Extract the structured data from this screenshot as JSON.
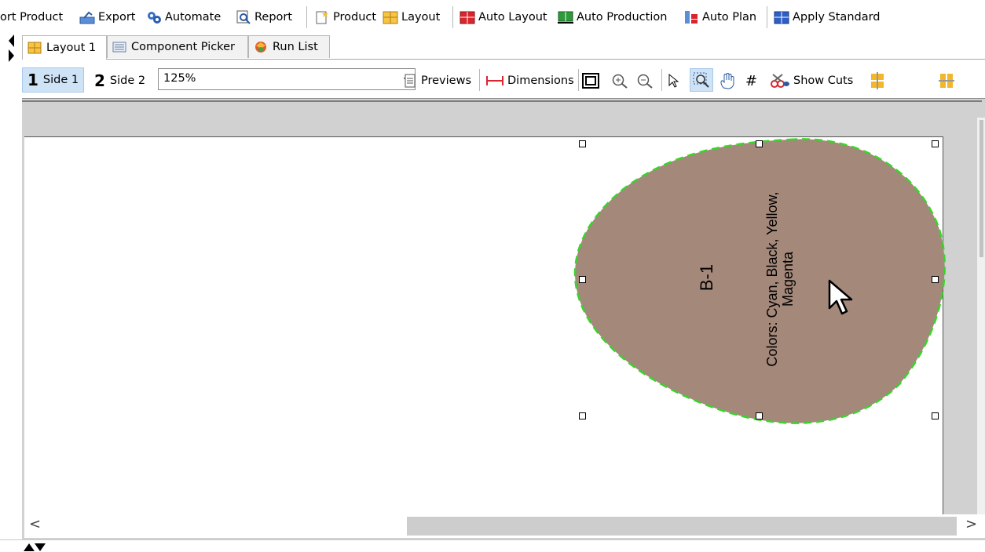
{
  "toolbar": {
    "import_product": "ort Product",
    "export": "Export",
    "automate": "Automate",
    "report": "Report",
    "product": "Product",
    "layout": "Layout",
    "auto_layout": "Auto Layout",
    "auto_production": "Auto Production",
    "auto_plan": "Auto Plan",
    "apply_standard": "Apply Standard"
  },
  "tabs": [
    {
      "label": "Layout 1",
      "active": true
    },
    {
      "label": "Component Picker",
      "active": false
    },
    {
      "label": "Run List",
      "active": false
    }
  ],
  "view_toolbar": {
    "side1_num": "1",
    "side1_label": "Side 1",
    "side2_num": "2",
    "side2_label": "Side 2",
    "zoom": "125%",
    "previews": "Previews",
    "dimensions": "Dimensions",
    "show_cuts": "Show Cuts"
  },
  "canvas": {
    "shape_label": "B-1",
    "colors_line1": "Colors: Cyan, Black, Yellow,",
    "colors_line2": "Magenta",
    "shape_fill": "#a4887a",
    "cut_line_color": "#39d42c"
  },
  "scroll": {
    "left_arrow": "<",
    "right_arrow": ">"
  }
}
